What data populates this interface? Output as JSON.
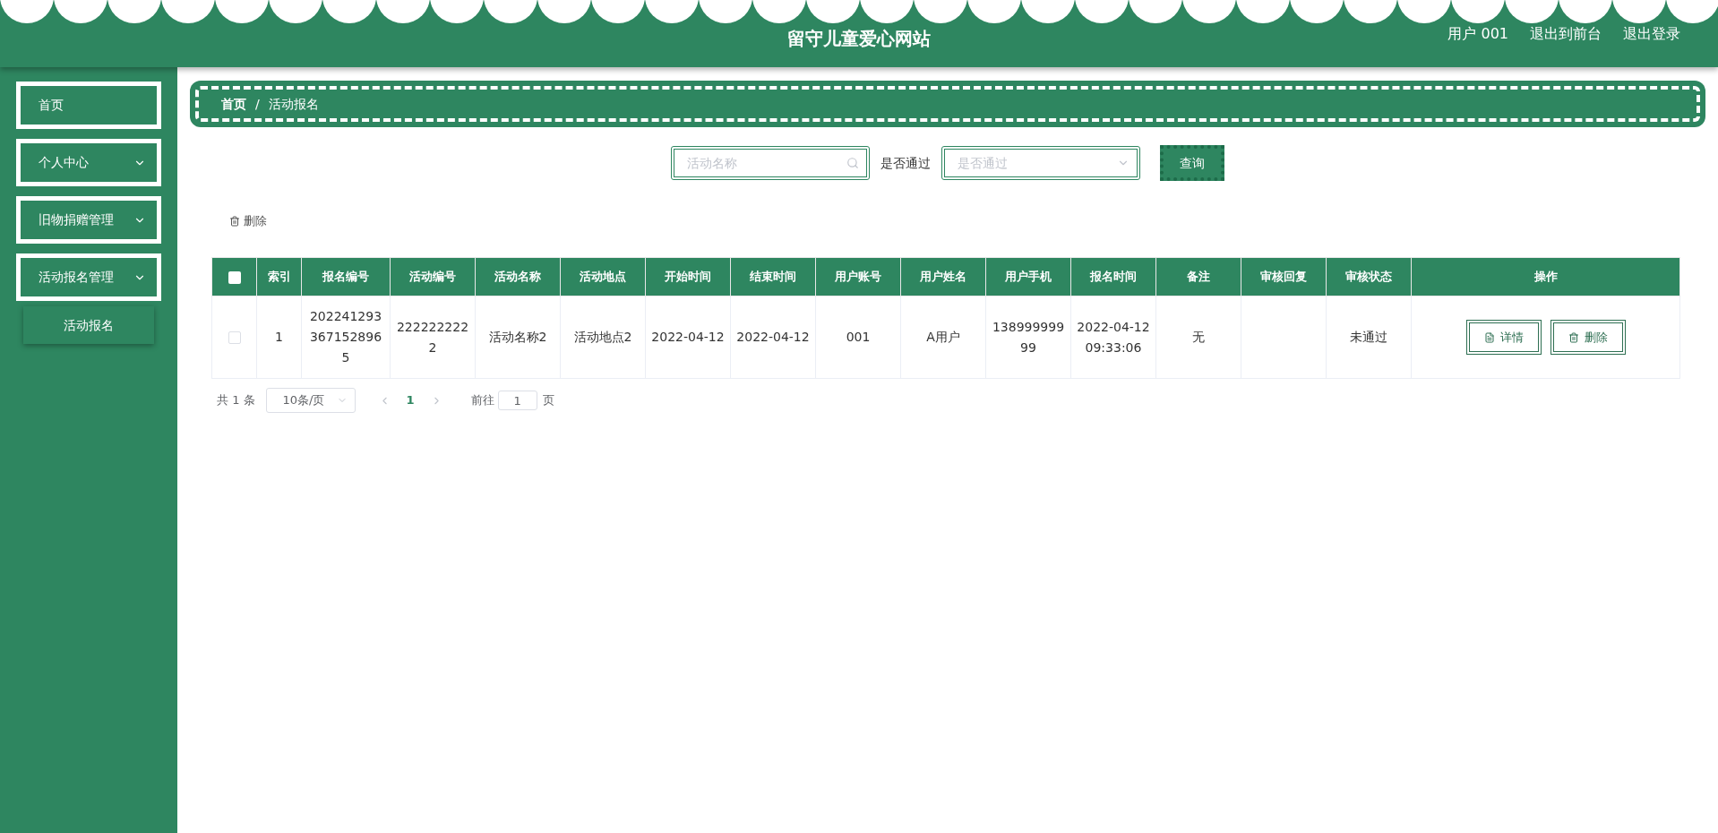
{
  "header": {
    "title": "留守儿童爱心网站",
    "user": "用户 001",
    "links": [
      "退出到前台",
      "退出登录"
    ]
  },
  "sidebar": {
    "items": [
      {
        "label": "首页",
        "kind": "link"
      },
      {
        "label": "个人中心",
        "kind": "submenu"
      },
      {
        "label": "旧物捐赠管理",
        "kind": "submenu"
      },
      {
        "label": "活动报名管理",
        "kind": "submenu",
        "children": [
          {
            "label": "活动报名",
            "selected": true
          }
        ]
      }
    ]
  },
  "breadcrumb": [
    "首页",
    "/",
    "活动报名"
  ],
  "search": {
    "name_placeholder": "活动名称",
    "pass_label": "是否通过",
    "pass_placeholder": "是否通过",
    "query_button": "查询"
  },
  "toolbar": {
    "delete_button": "删除"
  },
  "table": {
    "all_selected": false,
    "columns": [
      "索引",
      "报名编号",
      "活动编号",
      "活动名称",
      "活动地点",
      "开始时间",
      "结束时间",
      "用户账号",
      "用户姓名",
      "用户手机",
      "报名时间",
      "备注",
      "审核回复",
      "审核状态",
      "操作"
    ],
    "rows": [
      {
        "selected": false,
        "cells": [
          "1",
          "2022412933671528965",
          "2222222222",
          "活动名称2",
          "活动地点2",
          "2022-04-12",
          "2022-04-12",
          "001",
          "A用户",
          "13899999999",
          "2022-04-12 09:33:06",
          "无",
          "",
          "未通过"
        ],
        "actions": [
          "详情",
          "删除"
        ]
      }
    ]
  },
  "pagination": {
    "total": "共 1 条",
    "page_size": "10条/页",
    "pages": [
      {
        "label": "1",
        "selected": true
      }
    ],
    "goto_label": "前往",
    "goto_value": "1",
    "goto_suffix": "页"
  }
}
